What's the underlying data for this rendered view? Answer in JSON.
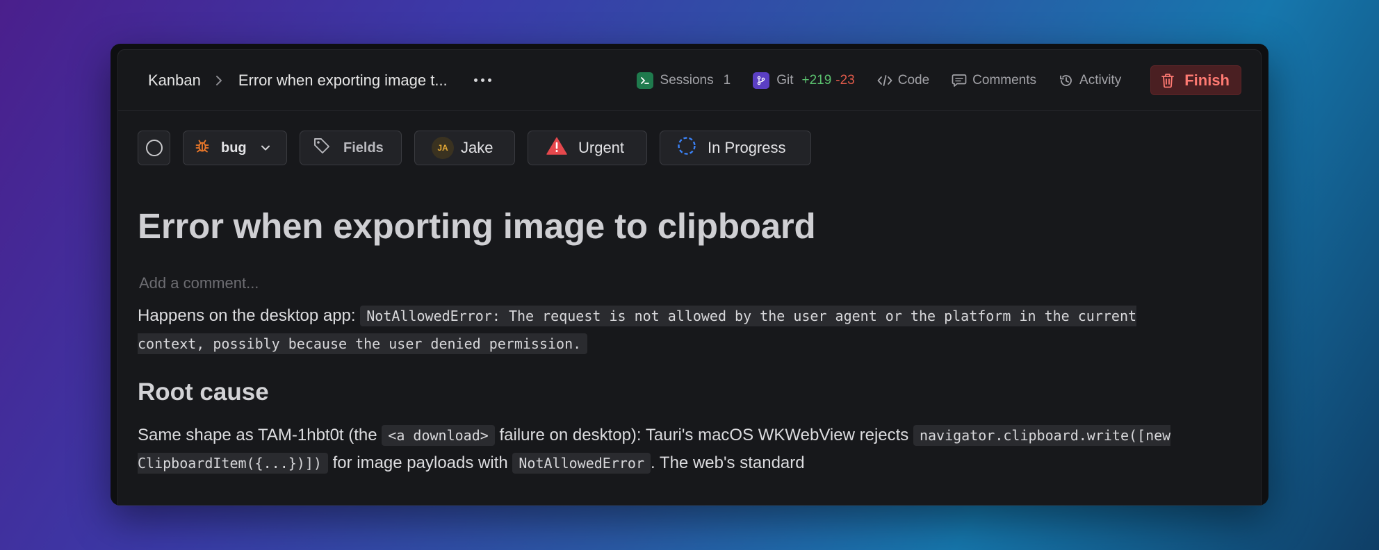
{
  "breadcrumb": {
    "root": "Kanban",
    "current": "Error when exporting image t..."
  },
  "tabs": {
    "sessions": {
      "label": "Sessions",
      "count": "1"
    },
    "git": {
      "label": "Git",
      "additions": "+219",
      "deletions": "-23"
    },
    "code": {
      "label": "Code"
    },
    "comments": {
      "label": "Comments"
    },
    "activity": {
      "label": "Activity"
    }
  },
  "finish_label": "Finish",
  "chips": {
    "type": "bug",
    "fields": "Fields",
    "assignee": {
      "initials": "JA",
      "name": "Jake"
    },
    "priority": "Urgent",
    "status": "In Progress"
  },
  "issue": {
    "title": "Error when exporting image to clipboard",
    "comment_placeholder": "Add a comment...",
    "p1_prefix": "Happens on the desktop app:",
    "p1_code": "NotAllowedError: The request is not allowed by the user agent or the platform in the current context, possibly because the user denied permission.",
    "heading": "Root cause",
    "p2_a": "Same shape as TAM-1hbt0t (the",
    "p2_code1": "<a download>",
    "p2_b": "failure on desktop): Tauri's macOS WKWebView rejects",
    "p2_code2": "navigator.clipboard.write([new ClipboardItem({...})])",
    "p2_c": "for image payloads with",
    "p2_code3": "NotAllowedError",
    "p2_d": ". The web's standard"
  },
  "colors": {
    "finish_text": "#ff7a72",
    "git_add": "#5bc26f",
    "git_del": "#e05a4a",
    "bug_icon": "#f07a2a",
    "urgent_icon": "#e5484d",
    "progress_icon": "#3b82f6"
  }
}
